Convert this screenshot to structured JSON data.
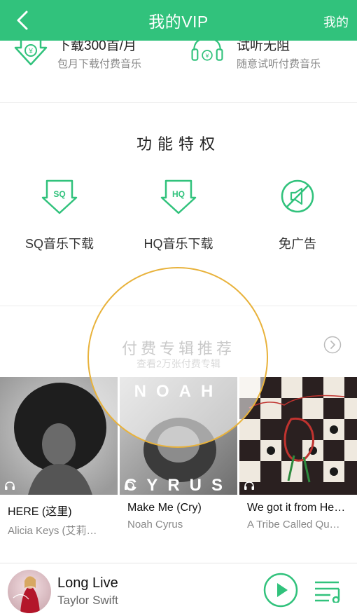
{
  "header": {
    "title": "我的VIP",
    "right_link": "我的"
  },
  "perks": [
    {
      "title": "下载300首/月",
      "subtitle": "包月下载付费音乐",
      "icon": "download-yuan-icon"
    },
    {
      "title": "试听无阻",
      "subtitle": "随意试听付费音乐",
      "icon": "headphones-yuan-icon"
    }
  ],
  "features": {
    "title": "功能特权",
    "items": [
      {
        "label": "SQ音乐下载",
        "icon": "sq-download-icon"
      },
      {
        "label": "HQ音乐下载",
        "icon": "hq-download-icon"
      },
      {
        "label": "免广告",
        "icon": "no-ads-icon"
      }
    ]
  },
  "recommend": {
    "title": "付费专辑推荐",
    "subtitle": "查看2万张付费专辑",
    "albums": [
      {
        "name": "HERE (这里)",
        "artist": "Alicia Keys (艾莉…"
      },
      {
        "name": "Make Me (Cry)",
        "artist": "Noah Cyrus",
        "cover_text_top": "NOAH",
        "cover_text_bottom": "CYRUS"
      },
      {
        "name": "We got it from He…",
        "artist": "A Tribe Called Qu…"
      }
    ]
  },
  "player": {
    "song": "Long Live",
    "artist": "Taylor Swift"
  },
  "colors": {
    "accent": "#31c27c",
    "highlight_ring": "#e8b23b"
  }
}
